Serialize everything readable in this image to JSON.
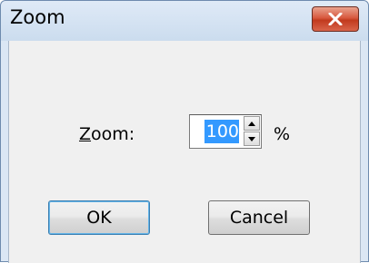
{
  "window": {
    "title": "Zoom"
  },
  "zoom": {
    "label_mnemonic": "Z",
    "label_rest": "oom:",
    "value": "100",
    "visible_text": "100",
    "unit": "%"
  },
  "buttons": {
    "ok_label": "OK",
    "cancel_label": "Cancel"
  },
  "colors": {
    "selection": "#3399ff",
    "close_button": "#c13a1e",
    "titlebar": "#cbdcee",
    "client": "#f0f0f0"
  },
  "icons": {
    "close": "close-icon",
    "spin_up": "spin-up-arrow-icon",
    "spin_down": "spin-down-arrow-icon"
  }
}
